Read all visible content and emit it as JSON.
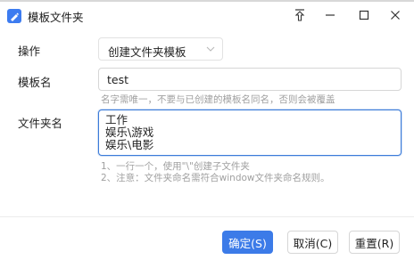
{
  "window": {
    "title": "模板文件夹",
    "icons": {
      "app": "app-icon",
      "pin": "pin-icon",
      "minimize": "minimize-icon",
      "maximize": "maximize-icon",
      "close": "close-icon"
    }
  },
  "form": {
    "operation": {
      "label": "操作",
      "selected": "创建文件夹模板"
    },
    "template_name": {
      "label": "模板名",
      "value": "test",
      "hint": "名字需唯一，不要与已创建的模板名同名，否则会被覆盖"
    },
    "folder_name": {
      "label": "文件夹名",
      "lines": [
        "工作",
        "娱乐\\游戏",
        "娱乐\\电影"
      ],
      "hints": [
        "1、一行一个，使用\"\\\"创建子文件夹",
        "2、注意：文件夹命名需符合window文件夹命名规则。"
      ]
    }
  },
  "buttons": {
    "ok": "确定(S)",
    "cancel": "取消(C)",
    "reset": "重置(R)"
  },
  "colors": {
    "accent": "#3c7be8",
    "focus_border": "#3b7bd9",
    "hint_text": "#a0a0a0"
  }
}
